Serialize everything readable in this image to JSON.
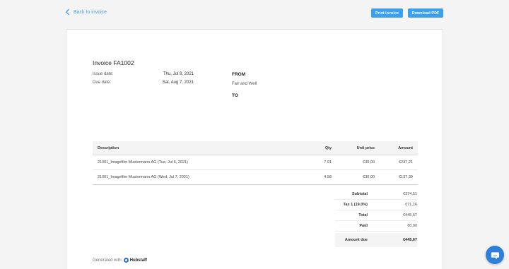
{
  "topbar": {
    "back_label": "Back to invoice",
    "print_label": "Print invoice",
    "download_label": "Download PDF"
  },
  "invoice": {
    "title": "Invoice FA1002",
    "issue_label": "Issue date:",
    "issue_value": "Thu, Jul 8, 2021",
    "due_label": "Due date:",
    "due_value": "Sat, Aug 7, 2021",
    "from_label": "FROM",
    "from_name": "Fair and Well",
    "to_label": "TO"
  },
  "table": {
    "headers": {
      "description": "Description",
      "qty": "Qty",
      "unit": "Unit price",
      "amount": "Amount"
    },
    "rows": [
      {
        "description": "21001_Imagefilm Mustermann AG (Tue, Jul 6, 2021)",
        "qty": "7.91",
        "unit": "€30,00",
        "amount": "€237,21"
      },
      {
        "description": "21001_Imagefilm Mustermann AG (Wed, Jul 7, 2021)",
        "qty": "4.58",
        "unit": "€30,00",
        "amount": "€137,30"
      }
    ]
  },
  "totals": {
    "subtotal_label": "Subtotal",
    "subtotal_value": "€374,51",
    "tax_label": "Tax 1 (19.0%)",
    "tax_value": "€71,16",
    "total_label": "Total",
    "total_value": "€445,67",
    "paid_label": "Paid",
    "paid_value": "€0,00",
    "due_label": "Amount due",
    "due_value": "€445,67"
  },
  "footer": {
    "generated_label": "Generated with",
    "brand": "Hubstaff"
  },
  "colors": {
    "accent": "#3aa0ef",
    "chat": "#2d7fd8"
  }
}
